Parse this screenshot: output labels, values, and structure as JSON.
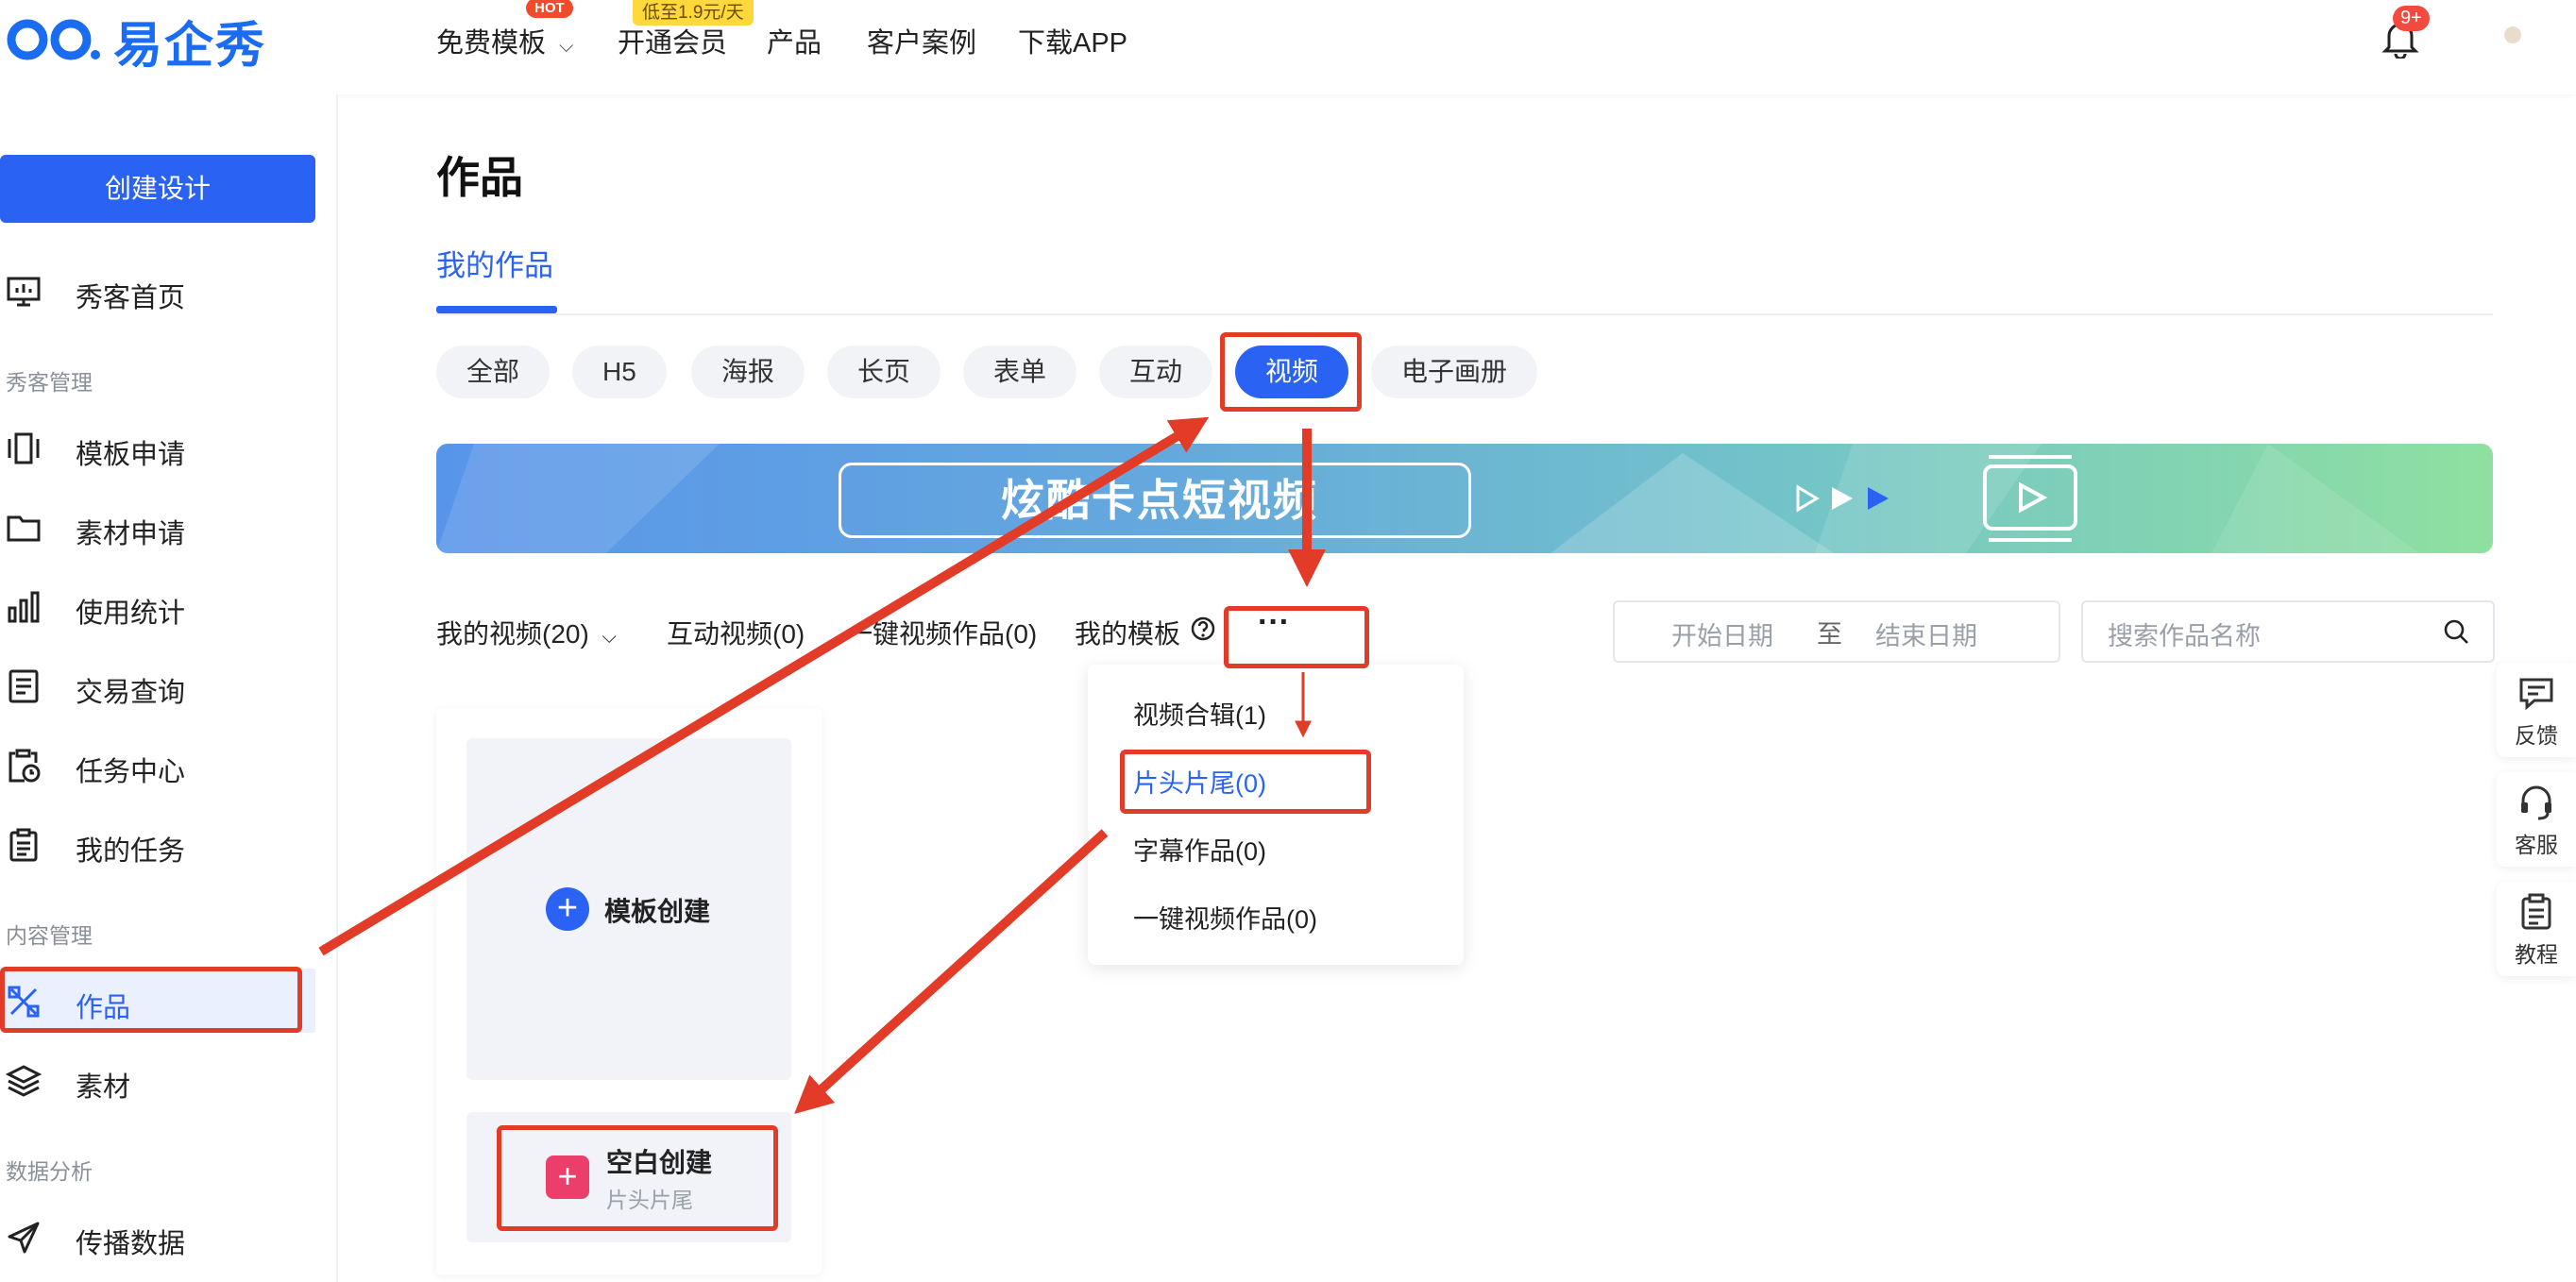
{
  "brand": {
    "name": "易企秀"
  },
  "topnav": {
    "items": [
      {
        "label": "免费模板",
        "badge": "HOT"
      },
      {
        "label": "开通会员",
        "badge": "低至1.9元/天"
      },
      {
        "label": "产品"
      },
      {
        "label": "客户案例"
      },
      {
        "label": "下载APP"
      }
    ],
    "notification_count": "9+"
  },
  "sidebar": {
    "create_button": "创建设计",
    "home": "秀客首页",
    "group_manage": "秀客管理",
    "items_manage": [
      "模板申请",
      "素材申请",
      "使用统计",
      "交易查询",
      "任务中心",
      "我的任务"
    ],
    "group_content": "内容管理",
    "items_content": [
      "作品",
      "素材"
    ],
    "group_data": "数据分析",
    "items_data": [
      "传播数据"
    ]
  },
  "main": {
    "title": "作品",
    "tab": "我的作品",
    "filters": [
      "全部",
      "H5",
      "海报",
      "长页",
      "表单",
      "互动",
      "视频",
      "电子画册"
    ],
    "active_filter": "视频",
    "banner_text": "炫酷卡点短视频",
    "subtabs": [
      "我的视频(20)",
      "互动视频(0)",
      "一键视频作品(0)",
      "我的模板"
    ],
    "more_label": "···",
    "date_start": "开始日期",
    "date_to": "至",
    "date_end": "结束日期",
    "search_placeholder": "搜索作品名称",
    "dropdown": [
      "视频合辑(1)",
      "片头片尾(0)",
      "字幕作品(0)",
      "一键视频作品(0)"
    ],
    "card_template": "模板创建",
    "card_blank": "空白创建",
    "card_blank_sub": "片头片尾"
  },
  "float_panel": [
    "反馈",
    "客服",
    "教程"
  ],
  "colors": {
    "accent": "#2a62f4",
    "annotation": "#e23b28"
  }
}
